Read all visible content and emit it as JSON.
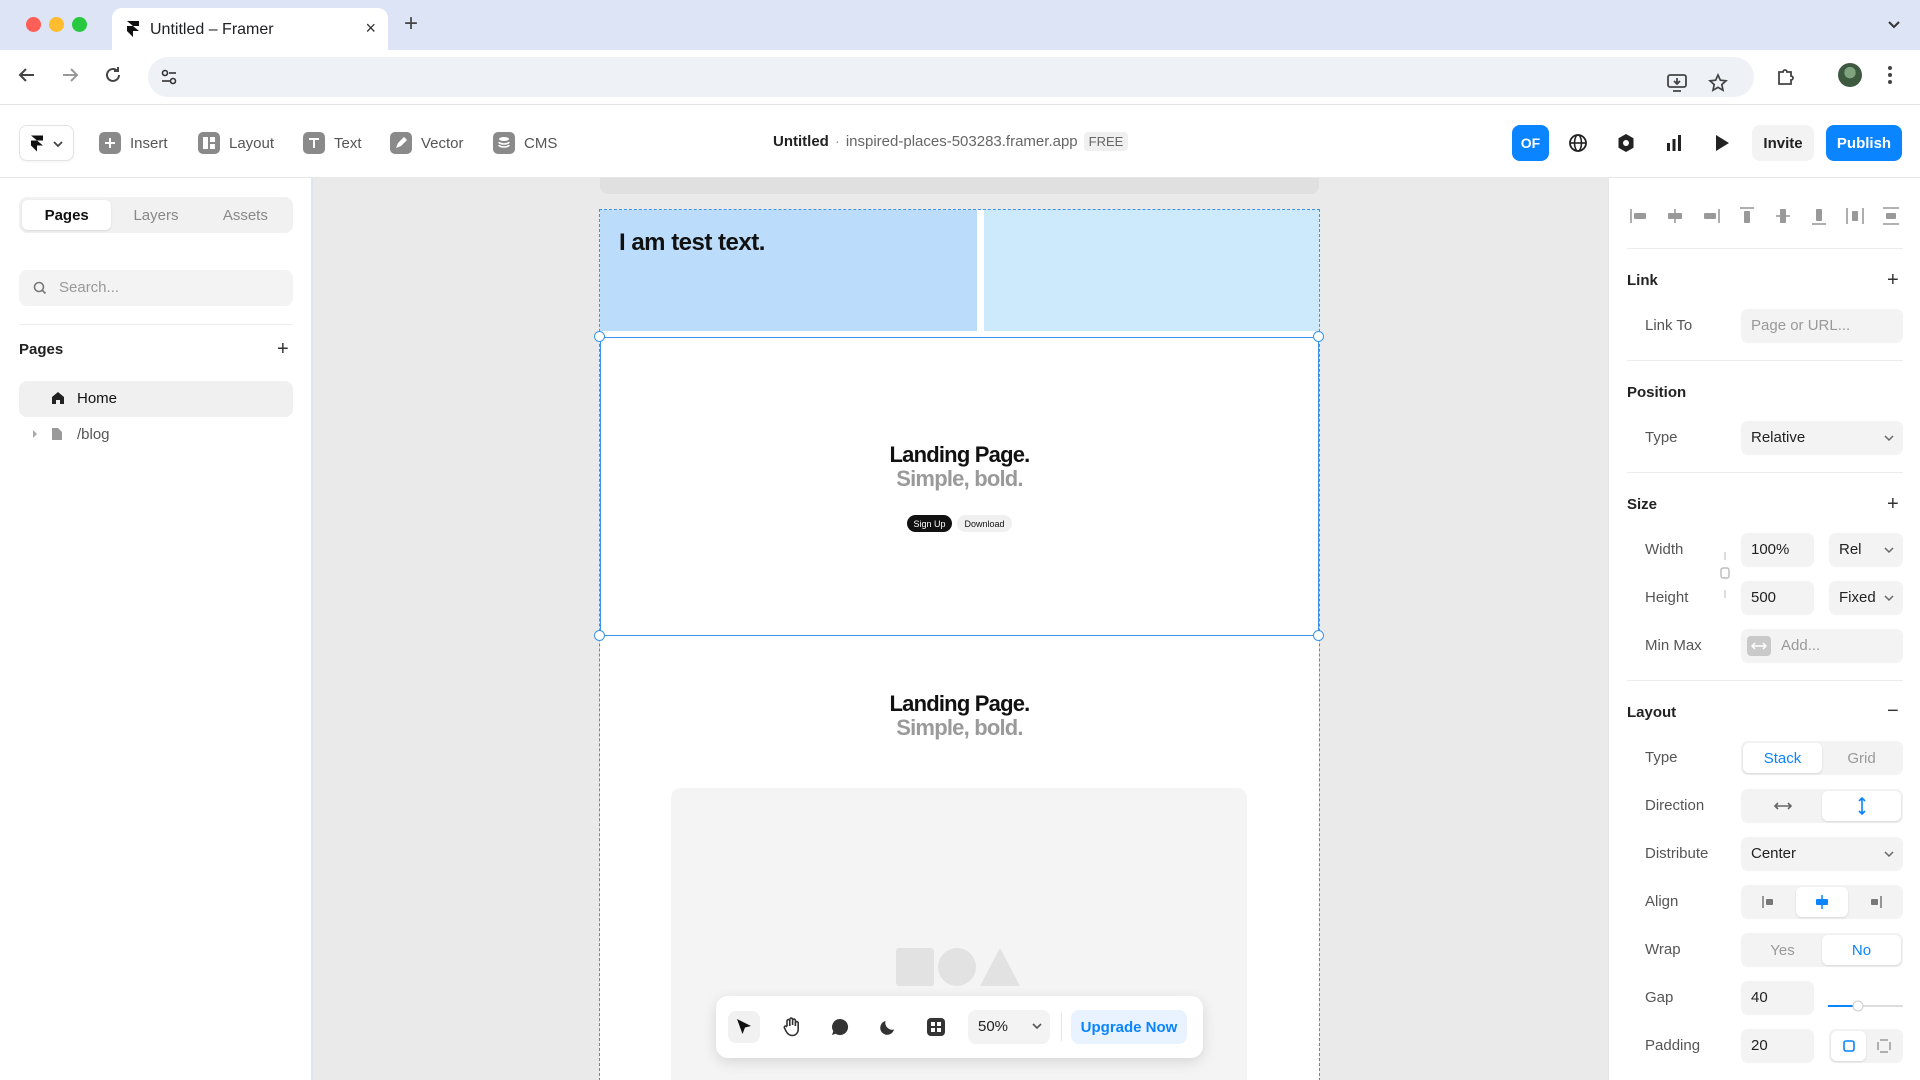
{
  "browser": {
    "tab_title": "Untitled – Framer",
    "tab_close": "×",
    "new_tab": "+"
  },
  "toolbar": {
    "tools": [
      {
        "label": "Insert",
        "icon": "plus-square-icon"
      },
      {
        "label": "Layout",
        "icon": "layout-icon"
      },
      {
        "label": "Text",
        "icon": "text-icon"
      },
      {
        "label": "Vector",
        "icon": "pen-icon"
      },
      {
        "label": "CMS",
        "icon": "database-icon"
      }
    ],
    "project_name": "Untitled",
    "separator": "·",
    "domain": "inspired-places-503283.framer.app",
    "plan_badge": "FREE",
    "avatar_initials": "OF",
    "invite_label": "Invite",
    "publish_label": "Publish"
  },
  "left_panel": {
    "tabs": [
      "Pages",
      "Layers",
      "Assets"
    ],
    "active_tab": "Pages",
    "search_placeholder": "Search...",
    "section_title": "Pages",
    "add_icon": "+",
    "pages": [
      {
        "label": "Home",
        "icon": "home-icon",
        "active": true
      },
      {
        "label": "/blog",
        "icon": "file-icon",
        "active": false
      }
    ]
  },
  "canvas": {
    "test_text": "I am test text.",
    "hero1": {
      "title": "Landing Page.",
      "subtitle": "Simple, bold.",
      "primary_button": "Sign Up",
      "secondary_button": "Download"
    },
    "hero2": {
      "title": "Landing Page.",
      "subtitle": "Simple, bold."
    },
    "selection_color": "#3b94ec",
    "bottom_bar": {
      "zoom": "50%",
      "upgrade_label": "Upgrade Now"
    }
  },
  "right_panel": {
    "link": {
      "title": "Link",
      "add": "+",
      "link_to_label": "Link To",
      "link_to_placeholder": "Page or URL..."
    },
    "position": {
      "title": "Position",
      "type_label": "Type",
      "type_value": "Relative"
    },
    "size": {
      "title": "Size",
      "add": "+",
      "width_label": "Width",
      "width_value": "100%",
      "width_unit": "Rel",
      "height_label": "Height",
      "height_value": "500",
      "height_unit": "Fixed",
      "minmax_label": "Min Max",
      "minmax_placeholder": "Add..."
    },
    "layout": {
      "title": "Layout",
      "collapse": "−",
      "type_label": "Type",
      "type_options": [
        "Stack",
        "Grid"
      ],
      "type_value": "Stack",
      "direction_label": "Direction",
      "direction_value": "vertical",
      "distribute_label": "Distribute",
      "distribute_value": "Center",
      "align_label": "Align",
      "align_value": "center",
      "wrap_label": "Wrap",
      "wrap_options": [
        "Yes",
        "No"
      ],
      "wrap_value": "No",
      "gap_label": "Gap",
      "gap_value": "40",
      "padding_label": "Padding",
      "padding_value": "20"
    }
  },
  "colors": {
    "accent": "#0a84ff",
    "canvas_bg": "#eaeaea",
    "cell_blue": "#bcdcfb",
    "cell_light_blue": "#cde9fc"
  }
}
